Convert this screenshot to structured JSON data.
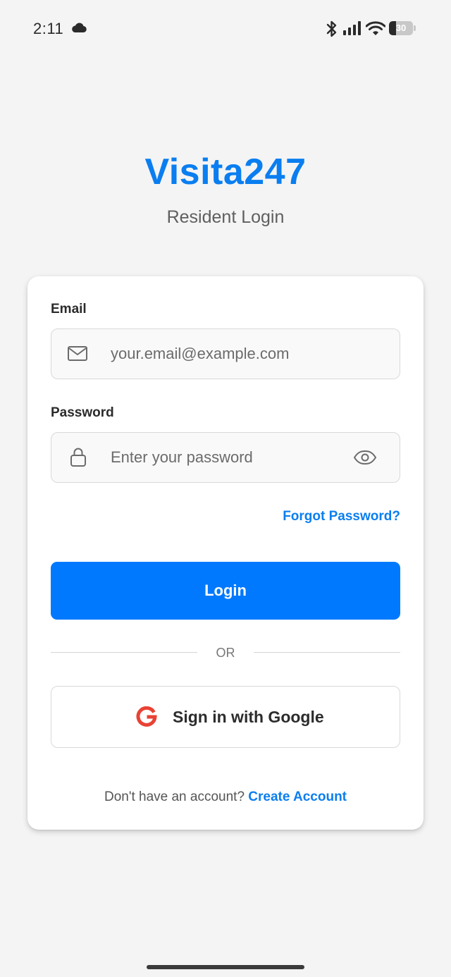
{
  "status_bar": {
    "time": "2:11",
    "battery_level": "30",
    "battery_fraction": 0.3
  },
  "header": {
    "title": "Visita247",
    "subtitle": "Resident Login"
  },
  "form": {
    "email_label": "Email",
    "email_placeholder": "your.email@example.com",
    "email_value": "",
    "password_label": "Password",
    "password_placeholder": "Enter your password",
    "password_value": "",
    "forgot_password": "Forgot Password?",
    "login_button": "Login",
    "divider_text": "OR",
    "google_button": "Sign in with Google",
    "signup_prompt": "Don't have an account? ",
    "signup_link": "Create Account"
  },
  "icons": {
    "cloud": "cloud-icon",
    "bluetooth": "bluetooth-icon",
    "signal": "signal-icon",
    "wifi": "wifi-icon",
    "battery": "battery-icon",
    "email": "mail-icon",
    "password": "lock-icon",
    "visibility": "eye-icon",
    "google": "google-icon"
  },
  "colors": {
    "accent": "#0a7ef0",
    "button": "#0079fe",
    "background": "#f4f4f4",
    "google_red": "#e94235"
  }
}
